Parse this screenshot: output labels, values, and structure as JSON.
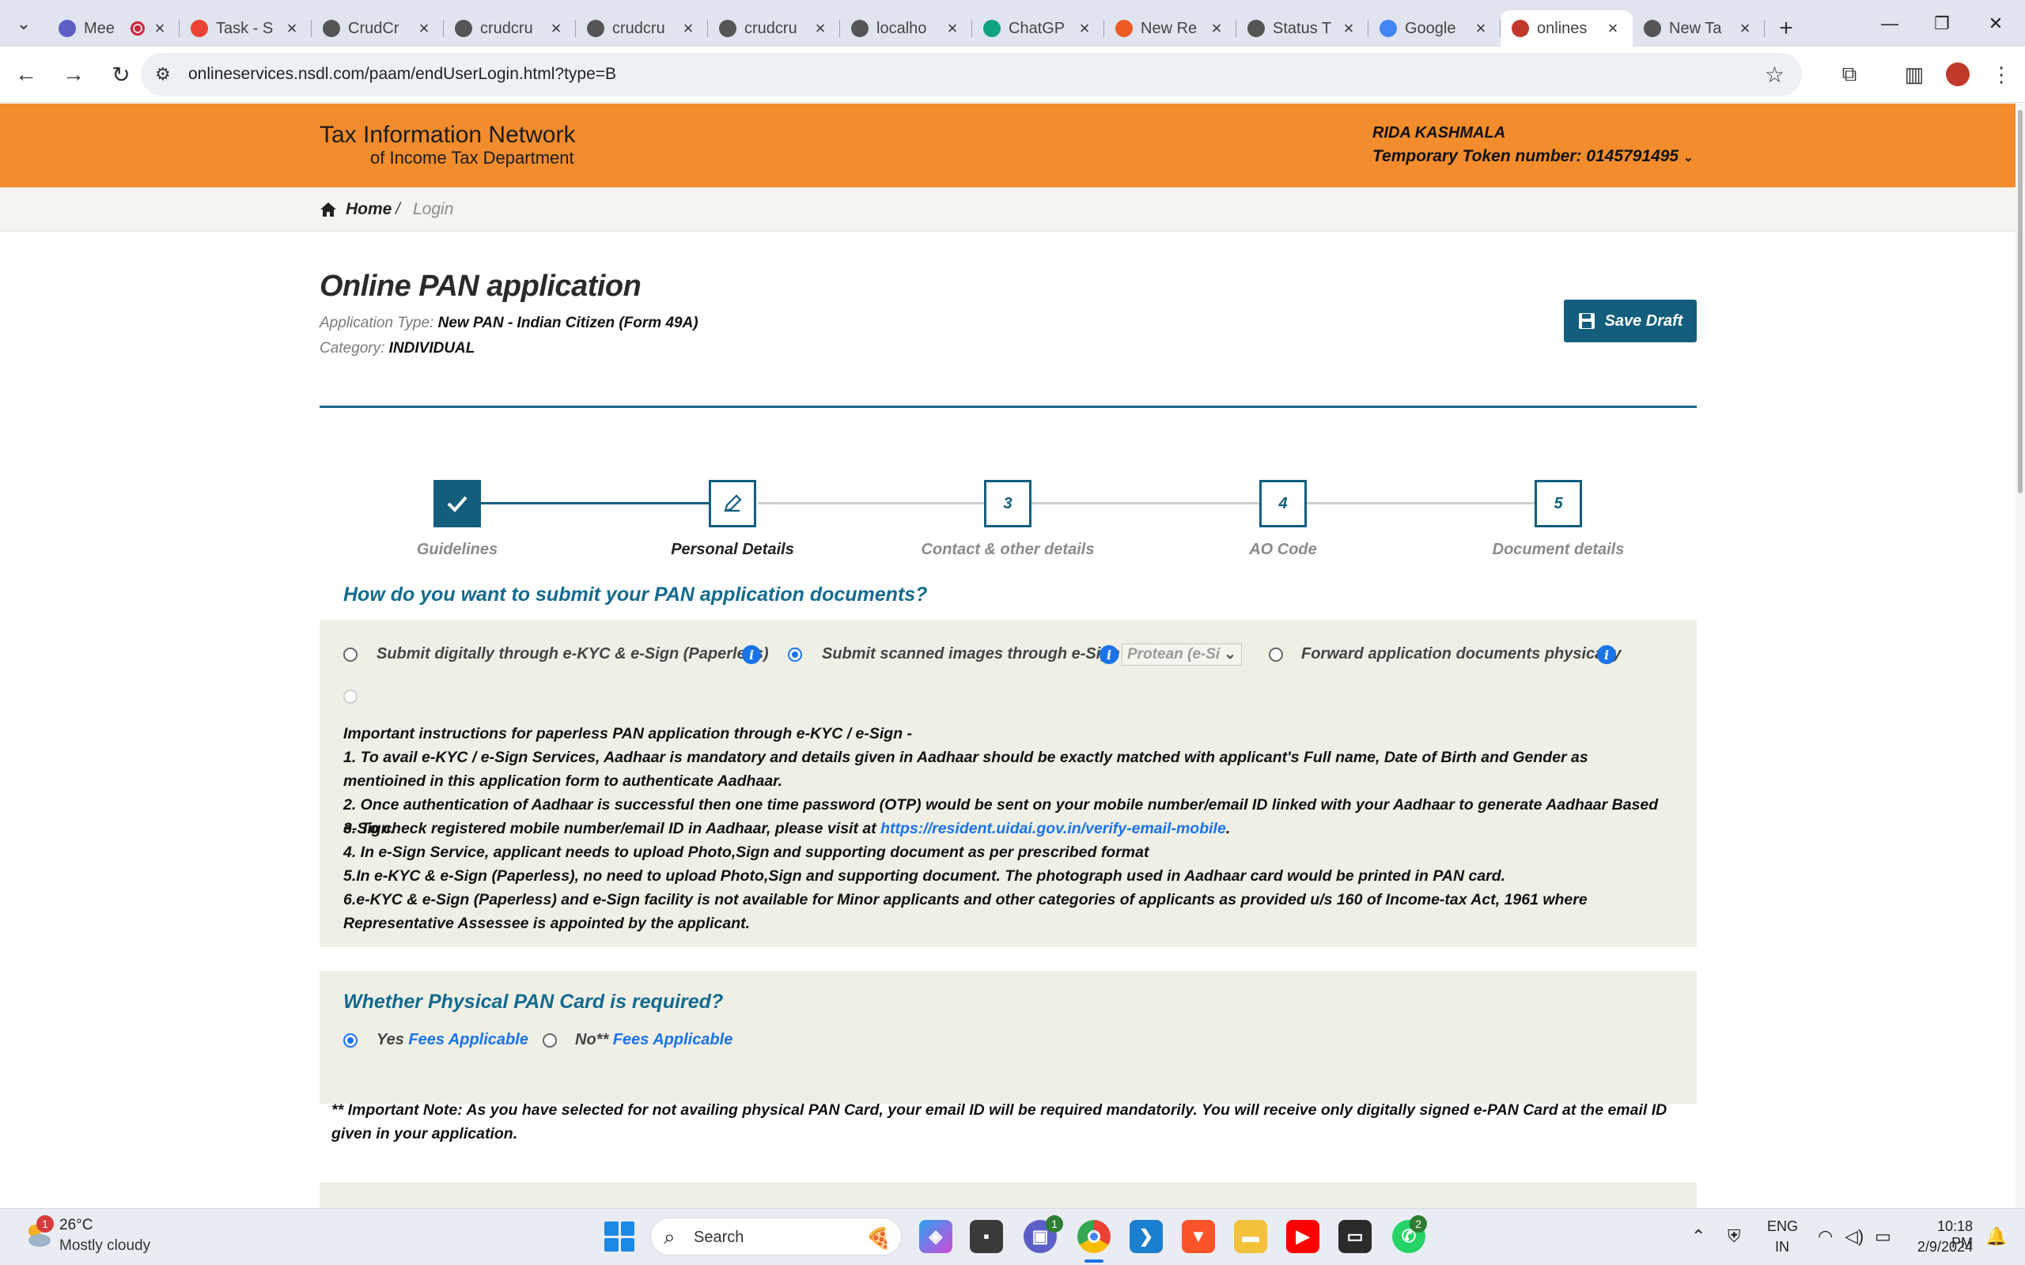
{
  "browser": {
    "tabs": [
      {
        "title": "Mee",
        "icon": "teams-icon",
        "color": "#5b5fc7"
      },
      {
        "title": "Task - S",
        "icon": "gmail-icon",
        "color": "#ea4335"
      },
      {
        "title": "CrudCr",
        "icon": "globe-icon",
        "color": "#555555"
      },
      {
        "title": "crudcru",
        "icon": "globe-icon",
        "color": "#555555"
      },
      {
        "title": "crudcru",
        "icon": "globe-icon",
        "color": "#555555"
      },
      {
        "title": "crudcru",
        "icon": "globe-icon",
        "color": "#555555"
      },
      {
        "title": "localho",
        "icon": "globe-icon",
        "color": "#555555"
      },
      {
        "title": "ChatGP",
        "icon": "chatgpt-icon",
        "color": "#10a37f"
      },
      {
        "title": "New Re",
        "icon": "postman-icon",
        "color": "#ef5b25"
      },
      {
        "title": "Status T",
        "icon": "globe-icon",
        "color": "#555555"
      },
      {
        "title": "Google",
        "icon": "google-icon",
        "color": "#4285f4"
      },
      {
        "title": "onlines",
        "icon": "nsdl-icon",
        "color": "#c0392b",
        "active": true
      },
      {
        "title": "New Ta",
        "icon": "chrome-icon",
        "color": "#555555"
      }
    ],
    "url": "onlineservices.nsdl.com/paam/endUserLogin.html?type=B"
  },
  "header": {
    "logo_line1": "Tax Information Network",
    "logo_line2": "of Income Tax Department",
    "user_name": "RIDA KASHMALA",
    "token": "Temporary Token number: 0145791495",
    "bg_color": "#f28c2c"
  },
  "breadcrumb": {
    "home": "Home",
    "sep": "/",
    "current": "Login"
  },
  "page": {
    "title": "Online PAN application",
    "app_type_label": "Application Type:",
    "app_type_value": "New PAN - Indian Citizen (Form 49A)",
    "category_label": "Category:",
    "category_value": "INDIVIDUAL",
    "save_draft": "Save Draft",
    "accent_color": "#135e7d"
  },
  "stepper": {
    "steps": [
      {
        "num": "",
        "label": "Guidelines",
        "state": "done"
      },
      {
        "num": "",
        "label": "Personal Details",
        "state": "current"
      },
      {
        "num": "3",
        "label": "Contact & other details",
        "state": "todo"
      },
      {
        "num": "4",
        "label": "AO Code",
        "state": "todo"
      },
      {
        "num": "5",
        "label": "Document details",
        "state": "todo"
      }
    ]
  },
  "submission": {
    "heading": "How do you want to submit your PAN application documents?",
    "options": [
      {
        "label": "Submit digitally through e-KYC & e-Sign (Paperless)",
        "selected": false
      },
      {
        "label": "Submit scanned images through e-Sign",
        "selected": true
      },
      {
        "label": "Forward application documents physically",
        "selected": false
      }
    ],
    "esign_provider": "Protean (e-Si",
    "instructions_title": "Important instructions for paperless PAN application through e-KYC / e-Sign -",
    "instr1": "1. To avail e-KYC / e-Sign Services, Aadhaar is mandatory and details given in Aadhaar should be exactly matched with applicant's Full name, Date of Birth and Gender as mentioined in this application form to authenticate Aadhaar.",
    "instr2": "2. Once authentication of Aadhaar is successful then one time password (OTP) would be sent on your mobile number/email ID linked with your Aadhaar to generate Aadhaar Based e-Sign.",
    "instr3_pre": "3. To check registered mobile number/email ID in Aadhaar, please visit at ",
    "instr3_link": "https://resident.uidai.gov.in/verify-email-mobile",
    "instr3_post": ".",
    "instr4": "4. In e-Sign Service, applicant needs to upload Photo,Sign and supporting document as per prescribed format",
    "instr5": "5.In e-KYC & e-Sign (Paperless), no need to upload Photo,Sign and supporting document. The photograph used in Aadhaar card would be printed in PAN card.",
    "instr6": "6.e-KYC & e-Sign (Paperless) and e-Sign facility is not available for Minor applicants and other categories of applicants as provided u/s 160 of Income-tax Act, 1961 where Representative Assessee is appointed by the applicant."
  },
  "physical": {
    "heading": "Whether Physical PAN Card is required?",
    "yes_label": "Yes",
    "yes_fees": "Fees Applicable",
    "no_label": "No**",
    "no_fees": "Fees Applicable",
    "yes_selected": true,
    "note": "** Important Note: As you have selected for not availing physical PAN Card, your email ID will be required mandatorily. You will receive only digitally signed e-PAN Card at the email ID given in your application."
  },
  "taskbar": {
    "temp": "26°C",
    "condition": "Mostly cloudy",
    "weather_badge": "1",
    "search_placeholder": "Search",
    "teams_badge": "1",
    "whatsapp_badge": "2",
    "lang1": "ENG",
    "lang2": "IN",
    "time": "10:18 PM",
    "date": "2/9/2024"
  }
}
